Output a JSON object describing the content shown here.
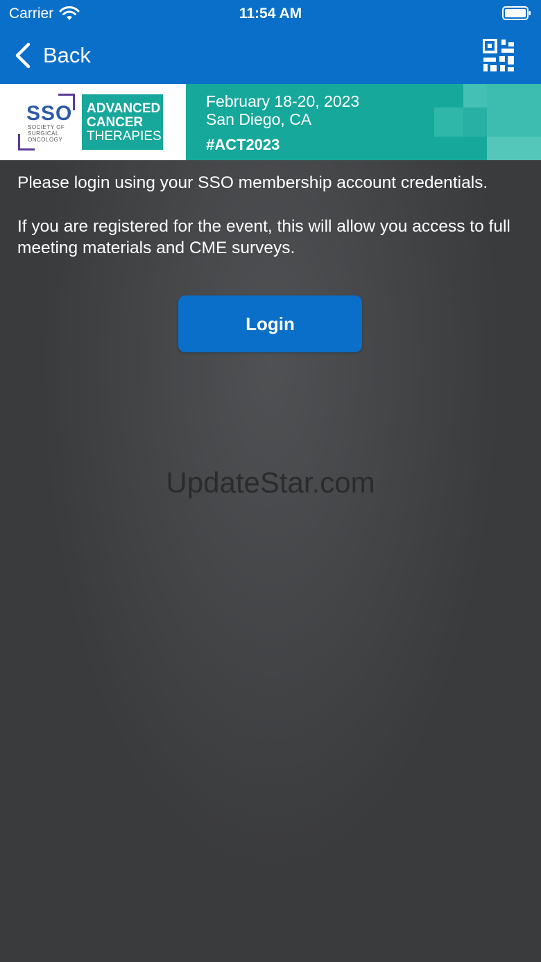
{
  "status_bar": {
    "carrier": "Carrier",
    "time": "11:54 AM"
  },
  "nav": {
    "back_label": "Back",
    "back_icon": "chevron-left-icon",
    "qr_icon": "qr-code-icon"
  },
  "banner": {
    "org_logo": {
      "sso": "SSO",
      "org_name_lines": [
        "SOCIETY OF",
        "SURGICAL",
        "ONCOLOGY"
      ]
    },
    "event_logo_lines": [
      "ADVANCED",
      "CANCER",
      "THERAPIES"
    ],
    "date": "February 18-20, 2023",
    "location": "San Diego, CA",
    "hashtag": "#ACT2023"
  },
  "content": {
    "instruction": "Please login using your SSO membership account credentials.",
    "info": "If you are registered for the event, this will allow you access to full meeting materials and CME surveys.",
    "login_button": "Login"
  },
  "watermark": "UpdateStar.com",
  "colors": {
    "primary": "#0a6fc9",
    "banner_teal": "#16a89b",
    "background": "#3a3b3d"
  }
}
